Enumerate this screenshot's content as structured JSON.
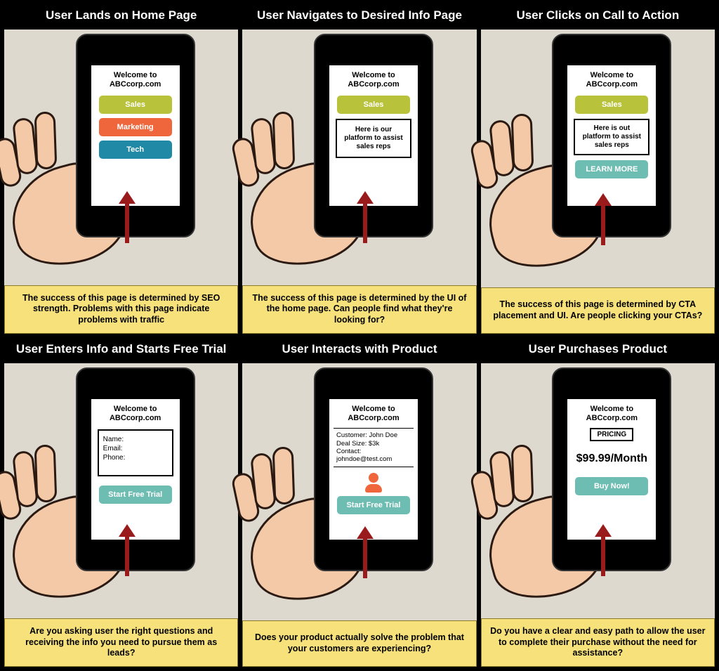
{
  "welcome": "Welcome to ABCcorp.com",
  "panels": [
    {
      "title": "User Lands on Home Page",
      "caption": "The success of this page is determined by SEO strength. Problems with this page indicate problems with traffic",
      "screen": {
        "type": "home",
        "buttons": [
          "Sales",
          "Marketing",
          "Tech"
        ]
      }
    },
    {
      "title": "User Navigates to Desired Info Page",
      "caption": "The success of this page is determined by the UI of the home page. Can people find what they're looking for?",
      "screen": {
        "type": "info",
        "button": "Sales",
        "info_text": "Here is our platform to assist sales reps"
      }
    },
    {
      "title": "User Clicks on Call to Action",
      "caption": "The success of this page is determined by CTA placement and UI. Are people clicking your CTAs?",
      "screen": {
        "type": "cta",
        "button": "Sales",
        "info_text": "Here is out platform to assist sales reps",
        "cta_label": "LEARN MORE"
      }
    },
    {
      "title": "User Enters Info and Starts Free Trial",
      "caption": "Are you asking user the right questions and receiving the info you need to pursue them as leads?",
      "screen": {
        "type": "form",
        "fields": [
          "Name:",
          "Email:",
          "Phone:"
        ],
        "cta_label": "Start Free Trial"
      }
    },
    {
      "title": "User Interacts with Product",
      "caption": "Does your product actually solve the problem that your customers are experiencing?",
      "screen": {
        "type": "product",
        "lines": [
          "Customer: John Doe",
          "Deal Size: $3k",
          "Contact: johndoe@test.com"
        ],
        "cta_label": "Start Free Trial"
      }
    },
    {
      "title": "User Purchases Product",
      "caption": "Do you have a clear and easy path to allow the user to complete their purchase without the need for assistance?",
      "screen": {
        "type": "purchase",
        "pricing_label": "PRICING",
        "price": "$99.99/Month",
        "cta_label": "Buy Now!"
      }
    }
  ]
}
